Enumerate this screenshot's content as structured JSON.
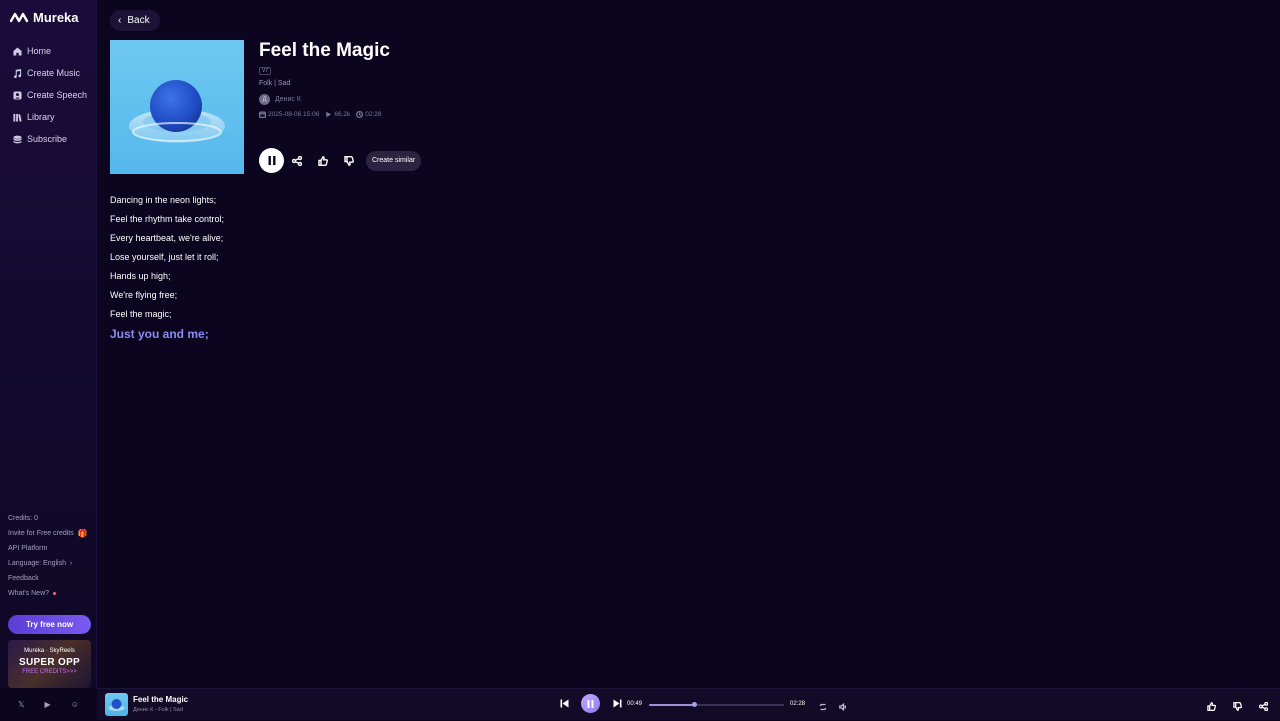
{
  "app": {
    "name": "Mureka"
  },
  "sidebar": {
    "nav": [
      {
        "label": "Home",
        "icon": "home-icon"
      },
      {
        "label": "Create Music",
        "icon": "music-note-icon"
      },
      {
        "label": "Create Speech",
        "icon": "speech-icon"
      },
      {
        "label": "Library",
        "icon": "library-icon"
      },
      {
        "label": "Subscribe",
        "icon": "subscribe-icon"
      }
    ],
    "credits": "Credits: 0",
    "invite": "Invite for Free credits",
    "api": "API Platform",
    "language": "Language: English",
    "feedback": "Feedback",
    "whats_new": "What's New?",
    "try_free": "Try free now",
    "promo": {
      "brand": "Mureka · SkyReels",
      "headline": "SUPER OPP",
      "sub": "FREE CREDITS>>>"
    }
  },
  "main": {
    "back": "Back",
    "song": {
      "title": "Feel the Magic",
      "version": "V7",
      "genre": "Folk | Sad",
      "author_initial": "Д",
      "author": "Денис К",
      "date": "2025-08-06 15:06",
      "plays": "66.2k",
      "duration": "02:28"
    },
    "create_similar": "Create similar",
    "lyrics": [
      "Dancing in the neon lights;",
      "Feel the rhythm take control;",
      "Every heartbeat, we're alive;",
      "Lose yourself, just let it roll;",
      "Hands up high;",
      "We're flying free;",
      "Feel the magic;",
      "Just you and me;"
    ],
    "active_lyric_index": 7
  },
  "player": {
    "title": "Feel the Magic",
    "subtitle": "Денис К - Folk | Sad",
    "current_time": "00:49",
    "total_time": "02:28",
    "progress": 0.33
  },
  "colors": {
    "background": "#0c0520",
    "accent": "#8d8af0",
    "try_button": "#5b3ed6"
  }
}
